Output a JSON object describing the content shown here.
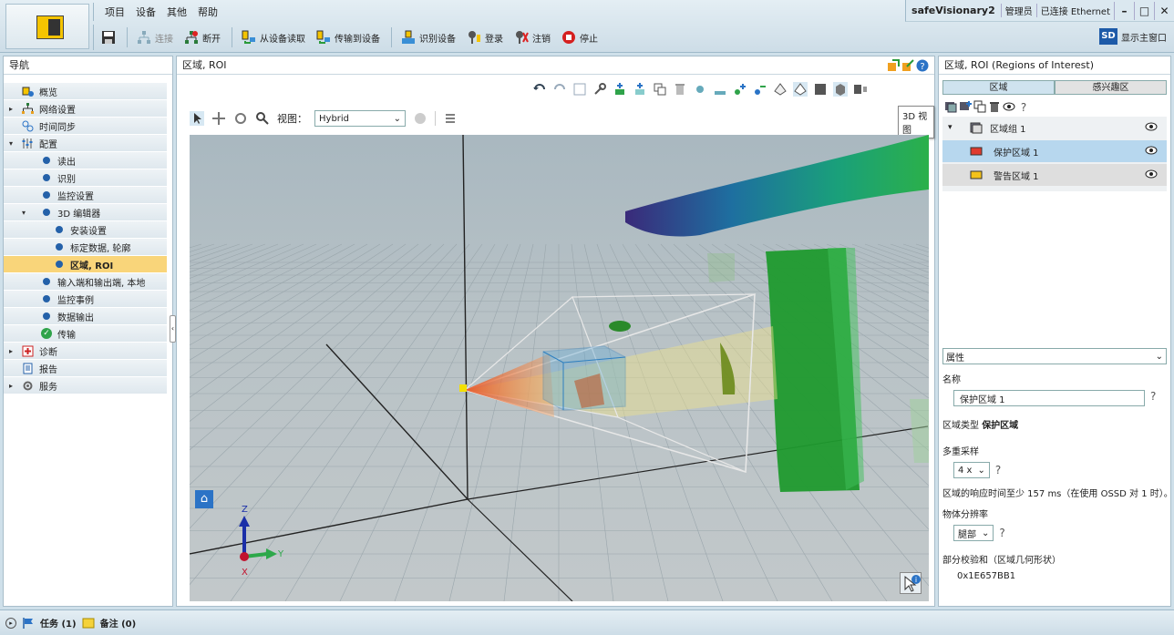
{
  "menu": [
    "项目",
    "设备",
    "其他",
    "帮助"
  ],
  "title_right": {
    "app": "safeVisionary2",
    "role": "管理员",
    "status": "已连接 Ethernet"
  },
  "window_buttons": [
    "–",
    "□",
    "✕"
  ],
  "toolbar": {
    "connect": "连接",
    "disconnect": "断开",
    "read_device": "从设备读取",
    "transfer_device": "传输到设备",
    "identify": "识别设备",
    "login": "登录",
    "logout": "注销",
    "stop": "停止",
    "show_main": "显示主窗口",
    "sd_badge": "SD"
  },
  "nav": {
    "title": "导航",
    "items": [
      {
        "label": "概览",
        "level": 0,
        "icon": "overview-icon"
      },
      {
        "label": "网络设置",
        "level": 0,
        "icon": "network-icon",
        "expander": "▸"
      },
      {
        "label": "时间同步",
        "level": 0,
        "icon": "time-sync-icon"
      },
      {
        "label": "配置",
        "level": 0,
        "icon": "config-icon",
        "expander": "▾"
      },
      {
        "label": "读出",
        "level": 1
      },
      {
        "label": "识别",
        "level": 1
      },
      {
        "label": "监控设置",
        "level": 1
      },
      {
        "label": "3D 编辑器",
        "level": 1,
        "expander": "▾"
      },
      {
        "label": "安装设置",
        "level": 2
      },
      {
        "label": "标定数据, 轮廓",
        "level": 2
      },
      {
        "label": "区域, ROI",
        "level": 2,
        "selected": true
      },
      {
        "label": "输入端和输出端, 本地",
        "level": 1
      },
      {
        "label": "监控事例",
        "level": 1
      },
      {
        "label": "数据输出",
        "level": 1
      },
      {
        "label": "传输",
        "level": 1,
        "done": true
      },
      {
        "label": "诊断",
        "level": 0,
        "icon": "diagnostics-icon",
        "expander": "▸"
      },
      {
        "label": "报告",
        "level": 0,
        "icon": "report-icon"
      },
      {
        "label": "服务",
        "level": 0,
        "icon": "service-icon",
        "expander": "▸"
      }
    ]
  },
  "center": {
    "title": "区域, ROI",
    "view_label": "视图：",
    "view_value": "Hybrid",
    "tooltip": "3D 视图",
    "axis_labels": {
      "z": "Z",
      "y": "Y",
      "x": "X"
    }
  },
  "right": {
    "title": "区域, ROI (Regions of Interest)",
    "tabs": [
      "区域",
      "感兴趣区"
    ],
    "group": "区域组 1",
    "regions": [
      {
        "label": "保护区域 1",
        "color": "#e03b2e",
        "selected": true
      },
      {
        "label": "警告区域 1",
        "color": "#f3c21a",
        "selected": false
      }
    ],
    "properties": {
      "section": "属性",
      "name_label": "名称",
      "name_value": "保护区域 1",
      "type_label": "区域类型",
      "type_value": "保护区域",
      "multisample_label": "多重采样",
      "multisample_value": "4 x",
      "response_text": "区域的响应时间至少 157 ms（在使用 OSSD 对 1 时）。",
      "resolution_label": "物体分辨率",
      "resolution_value": "腿部",
      "checksum_label": "部分校验和（区域几何形状）",
      "checksum_value": "0x1E657BB1"
    }
  },
  "status": {
    "tasks": "任务 (1)",
    "notes": "备注 (0)"
  },
  "colors": {
    "accent": "#2461a9",
    "selection": "#f9d57a",
    "panel_border": "#a8bdca"
  }
}
